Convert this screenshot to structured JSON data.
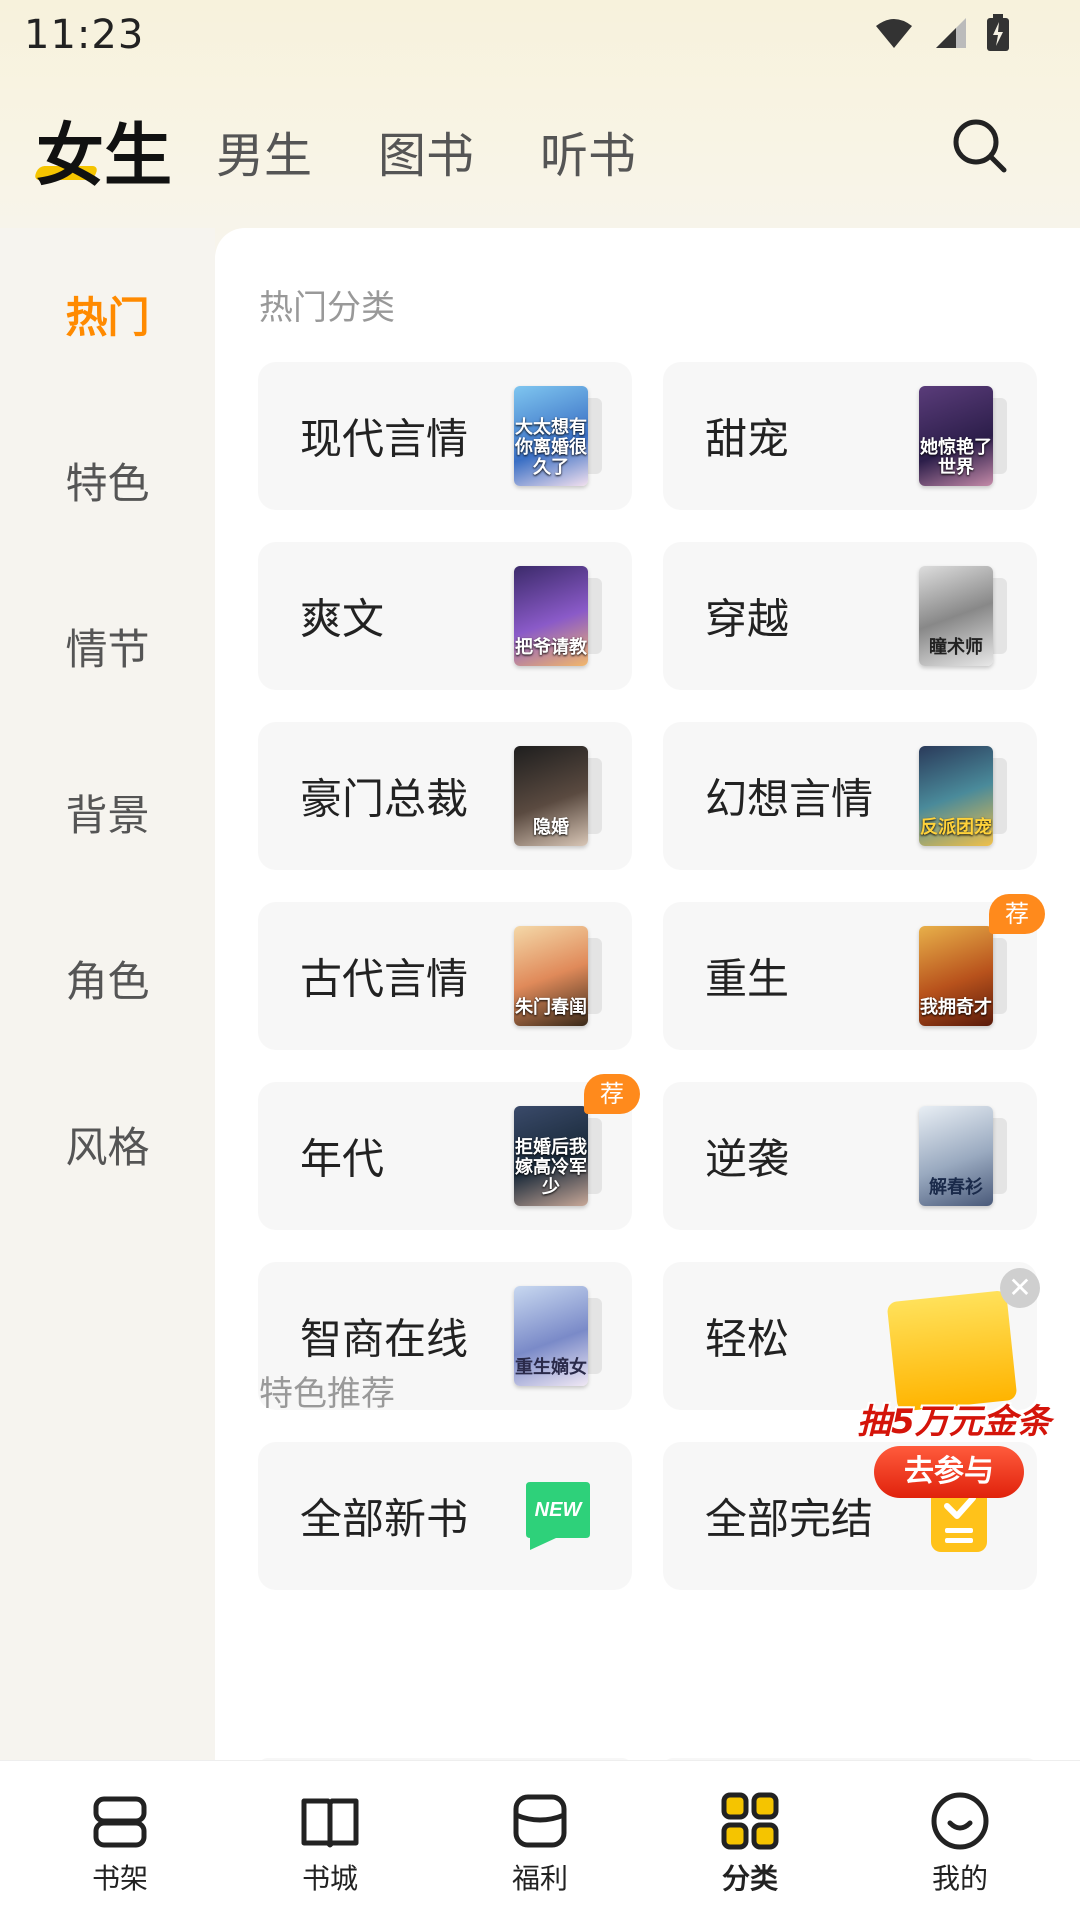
{
  "status_bar": {
    "time": "11:23"
  },
  "top_tabs": [
    {
      "label": "女生",
      "active": true
    },
    {
      "label": "男生",
      "active": false
    },
    {
      "label": "图书",
      "active": false
    },
    {
      "label": "听书",
      "active": false
    }
  ],
  "sidebar": {
    "items": [
      {
        "label": "热门",
        "active": true
      },
      {
        "label": "特色",
        "active": false
      },
      {
        "label": "情节",
        "active": false
      },
      {
        "label": "背景",
        "active": false
      },
      {
        "label": "角色",
        "active": false
      },
      {
        "label": "风格",
        "active": false
      }
    ]
  },
  "main": {
    "hot_section_title": "热门分类",
    "featured_section_title": "特色推荐",
    "categories": [
      {
        "label": "现代言情",
        "cover_text": "大太想有你离婚很久了"
      },
      {
        "label": "甜宠",
        "cover_text": "她惊艳了世界"
      },
      {
        "label": "爽文",
        "cover_text": "把爷请教"
      },
      {
        "label": "穿越",
        "cover_text": "瞳术师"
      },
      {
        "label": "豪门总裁",
        "cover_text": "隐婚"
      },
      {
        "label": "幻想言情",
        "cover_text": "反派团宠"
      },
      {
        "label": "古代言情",
        "cover_text": "朱门春闺"
      },
      {
        "label": "重生",
        "cover_text": "我拥奇才",
        "badge": "荐"
      },
      {
        "label": "年代",
        "cover_text": "拒婚后我嫁高冷军少",
        "badge": "荐"
      },
      {
        "label": "逆袭",
        "cover_text": "解春衫"
      },
      {
        "label": "智商在线",
        "cover_text": "重生嫡女"
      },
      {
        "label": "轻松",
        "cover_text": ""
      },
      {
        "label": "全部新书",
        "icon": "new-icon"
      },
      {
        "label": "全部完结",
        "icon": "completed-icon"
      }
    ],
    "new_badge_text": "NEW"
  },
  "promo": {
    "title": "抽5万元金条",
    "button": "去参与",
    "close": "✕"
  },
  "bottom_nav": [
    {
      "label": "书架",
      "icon": "bookshelf-icon",
      "active": false
    },
    {
      "label": "书城",
      "icon": "book-open-icon",
      "active": false
    },
    {
      "label": "福利",
      "icon": "gift-box-icon",
      "active": false
    },
    {
      "label": "分类",
      "icon": "category-grid-icon",
      "active": true
    },
    {
      "label": "我的",
      "icon": "smiley-profile-icon",
      "active": false
    }
  ],
  "colors": {
    "accent_orange": "#ff8a00",
    "accent_yellow": "#f5c400",
    "badge_orange": "#ff8a1c",
    "new_green": "#2ed17a"
  }
}
